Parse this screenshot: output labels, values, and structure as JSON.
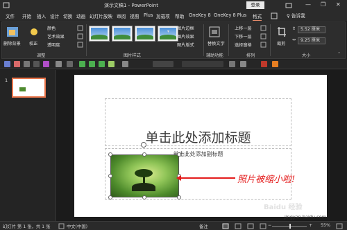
{
  "titlebar": {
    "title": "演示文稿1  -  PowerPoint",
    "login": "登录",
    "minimize": "—",
    "restore": "❐",
    "close": "✕"
  },
  "tabs": [
    {
      "label": "文件",
      "active": false
    },
    {
      "label": "开始",
      "active": false
    },
    {
      "label": "插入",
      "active": false
    },
    {
      "label": "设计",
      "active": false
    },
    {
      "label": "切换",
      "active": false
    },
    {
      "label": "动画",
      "active": false
    },
    {
      "label": "幻灯片放映",
      "active": false
    },
    {
      "label": "审阅",
      "active": false
    },
    {
      "label": "视图",
      "active": false
    },
    {
      "label": "Plus",
      "active": false
    },
    {
      "label": "加载项",
      "active": false
    },
    {
      "label": "帮助",
      "active": false
    },
    {
      "label": "OneKey 8",
      "active": false
    },
    {
      "label": "OneKey 8 Plus",
      "active": false
    },
    {
      "label": "格式",
      "active": true
    }
  ],
  "tell_me": "♀ 告诉我",
  "ribbon": {
    "remove_bg": "删除背景",
    "correct": "校正",
    "color": "颜色",
    "artistic": "艺术效果",
    "transparency": "透明度",
    "adjust_group": "调整",
    "styles_group": "图片样式",
    "border": "图片边框",
    "effects": "图片效果",
    "layout": "图片版式",
    "alt_text": "替换文字",
    "accessibility_group": "辅助功能",
    "bring_forward": "上移一层",
    "send_backward": "下移一层",
    "selection_pane": "选择窗格",
    "arrange_group": "排列",
    "crop": "裁剪",
    "height": "5.52 厘米",
    "width": "9.25 厘米",
    "size_group": "大小"
  },
  "slide_panel": {
    "number": "1"
  },
  "slide": {
    "title_placeholder": "单击此处添加标题",
    "subtitle_placeholder": "单击此处添加副标题",
    "callout": "照片被缩小啦!"
  },
  "status": {
    "slide_info": "幻灯片 第 1 张，共 1 张",
    "language": "中文(中国)",
    "notes": "备注",
    "zoom": "55%"
  },
  "watermark": {
    "brand": "Baidu 经验",
    "url": "jingyan.baidu.com"
  },
  "colors": {
    "accent": "#e9744a",
    "callout": "#e41c1c",
    "ribbon_bg": "#2d2d2d"
  }
}
